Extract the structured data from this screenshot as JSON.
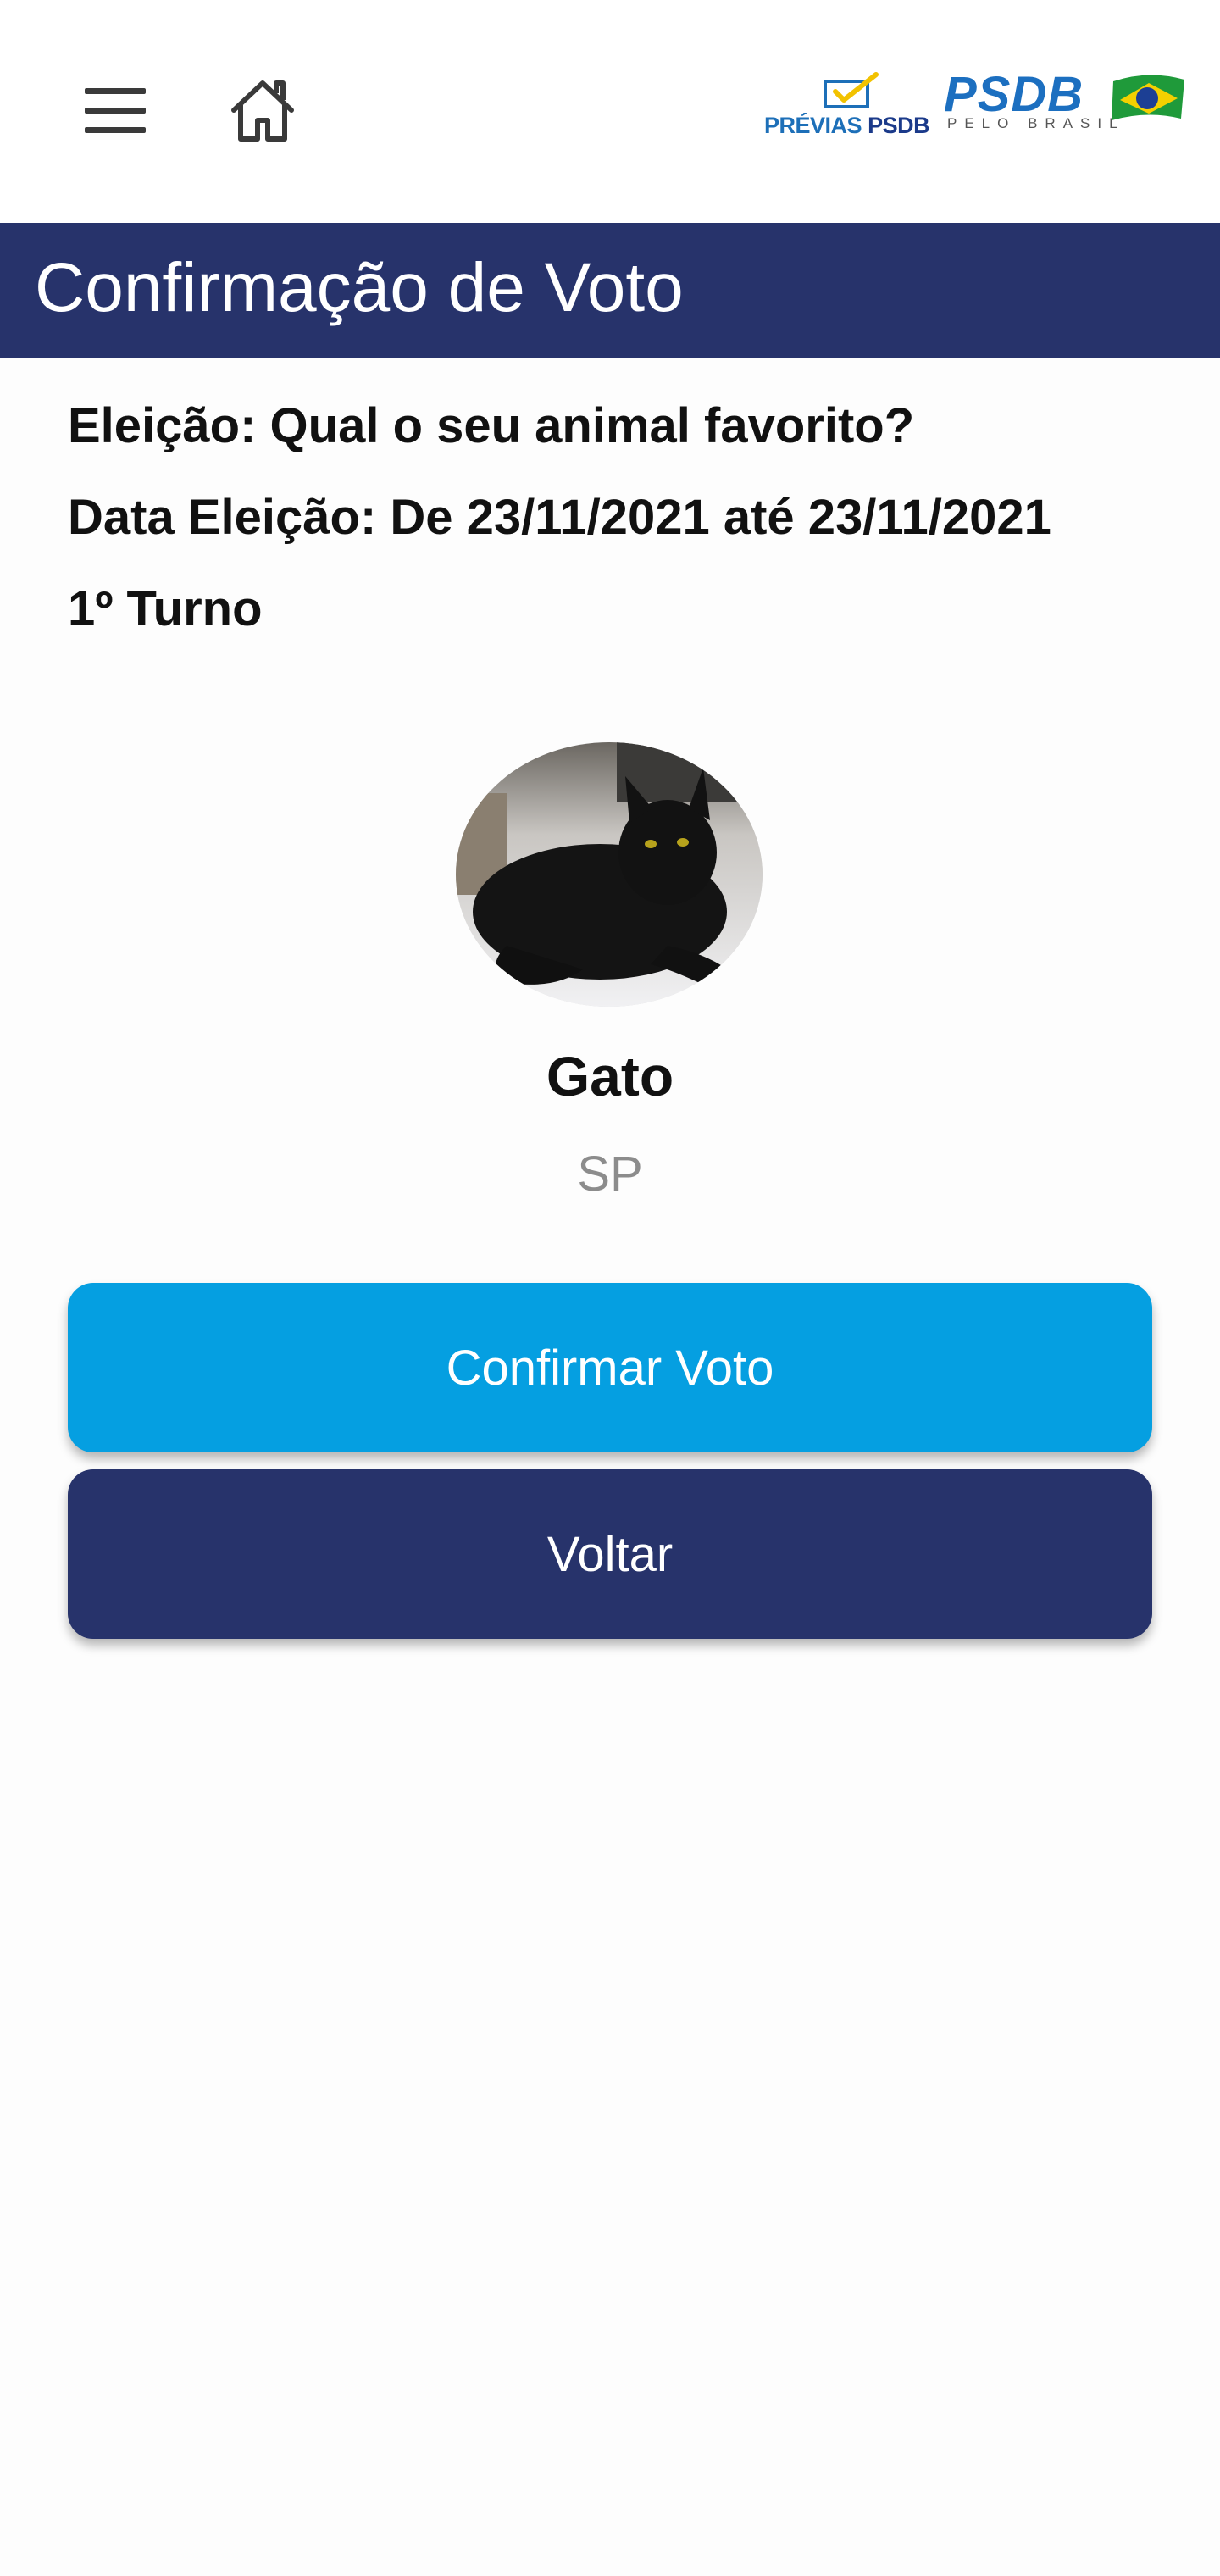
{
  "header": {
    "menu_icon": "hamburger-menu-icon",
    "home_icon": "home-icon",
    "logo_previas": {
      "text_prefix": "PRÉVIAS",
      "text_brand": "PSDB"
    },
    "logo_psdb": {
      "word": "PSDB",
      "subtitle": "PELO BRASIL"
    }
  },
  "page": {
    "title": "Confirmação de Voto"
  },
  "election": {
    "name_line": "Eleição: Qual o seu animal favorito?",
    "date_line": "Data Eleição: De 23/11/2021 até 23/11/2021",
    "round_line": "1º Turno"
  },
  "candidate": {
    "name": "Gato",
    "state": "SP",
    "photo": "black-cat-photo"
  },
  "actions": {
    "confirm_label": "Confirmar Voto",
    "back_label": "Voltar"
  },
  "colors": {
    "primary_dark": "#27336b",
    "primary_light": "#059fe1",
    "state_text": "#8c8c8c"
  }
}
